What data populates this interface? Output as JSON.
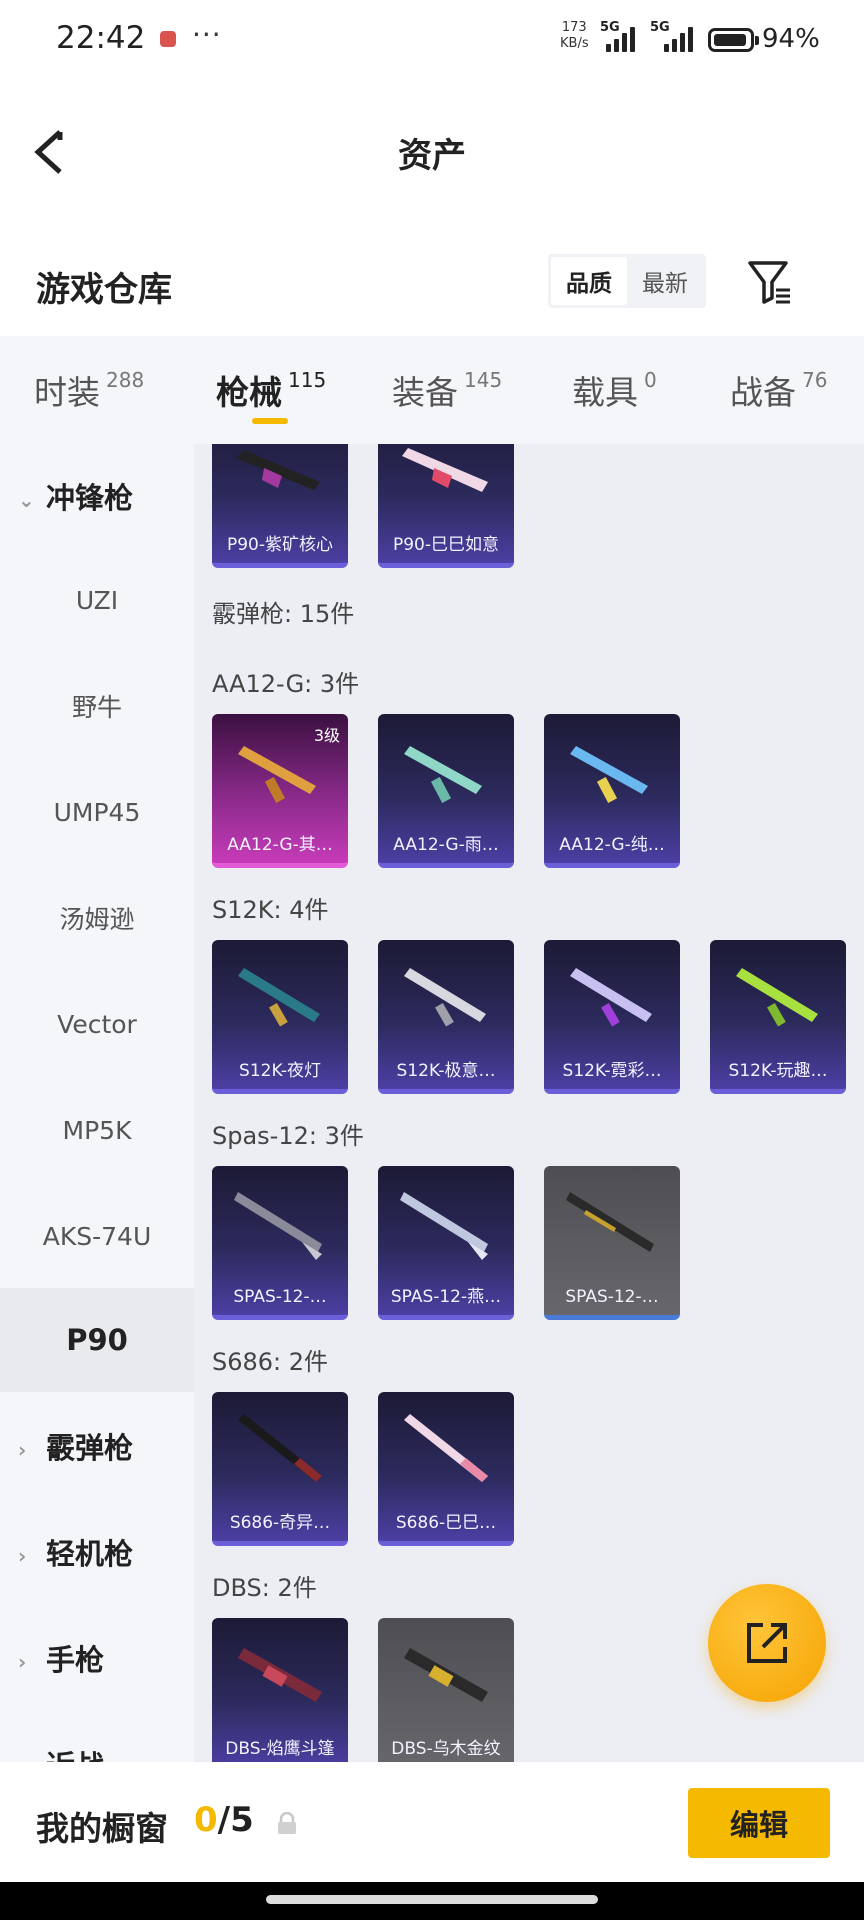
{
  "status_bar": {
    "time": "22:42",
    "more": "···",
    "net_speed_value": "173",
    "net_speed_unit": "KB/s",
    "network_1": "5G",
    "network_2": "5G",
    "battery": "94%"
  },
  "nav": {
    "title": "资产"
  },
  "section": {
    "title": "游戏仓库",
    "sort_options": [
      "品质",
      "最新"
    ],
    "sort_selected": "品质"
  },
  "tabs": [
    {
      "label": "时装",
      "count": "288"
    },
    {
      "label": "枪械",
      "count": "115",
      "active": true
    },
    {
      "label": "装备",
      "count": "145"
    },
    {
      "label": "载具",
      "count": "0"
    },
    {
      "label": "战备",
      "count": "76"
    }
  ],
  "sidebar": {
    "items": [
      {
        "label": "冲锋枪",
        "type": "group",
        "expanded": true
      },
      {
        "label": "UZI"
      },
      {
        "label": "野牛"
      },
      {
        "label": "UMP45"
      },
      {
        "label": "汤姆逊"
      },
      {
        "label": "Vector"
      },
      {
        "label": "MP5K"
      },
      {
        "label": "AKS-74U"
      },
      {
        "label": "P90",
        "selected": true
      },
      {
        "label": "霰弹枪",
        "type": "group",
        "expanded": false
      },
      {
        "label": "轻机枪",
        "type": "group",
        "expanded": false
      },
      {
        "label": "手枪",
        "type": "group",
        "expanded": false
      },
      {
        "label": "近战",
        "type": "group",
        "expanded": false
      }
    ]
  },
  "content": {
    "p90_items": [
      "P90-紫矿核心",
      "P90-巳巳如意"
    ],
    "category_label": "霰弹枪: 15件",
    "groups": [
      {
        "label": "AA12-G: 3件",
        "items": [
          {
            "name": "AA12-G-其…",
            "level": "3级",
            "style": "pink"
          },
          {
            "name": "AA12-G-雨…"
          },
          {
            "name": "AA12-G-纯…"
          }
        ]
      },
      {
        "label": "S12K: 4件",
        "items": [
          {
            "name": "S12K-夜灯"
          },
          {
            "name": "S12K-极意…"
          },
          {
            "name": "S12K-霓彩…"
          },
          {
            "name": "S12K-玩趣…"
          }
        ]
      },
      {
        "label": "Spas-12: 3件",
        "items": [
          {
            "name": "SPAS-12-…"
          },
          {
            "name": "SPAS-12-燕…"
          },
          {
            "name": "SPAS-12-…",
            "style": "grey"
          }
        ]
      },
      {
        "label": "S686: 2件",
        "items": [
          {
            "name": "S686-奇异…"
          },
          {
            "name": "S686-巳巳…"
          }
        ]
      },
      {
        "label": "DBS: 2件",
        "items": [
          {
            "name": "DBS-焰鹰斗篷"
          },
          {
            "name": "DBS-乌木金纹",
            "style": "grey"
          }
        ]
      }
    ]
  },
  "bottom_bar": {
    "title": "我的橱窗",
    "current": "0",
    "total": "/5",
    "edit_label": "编辑"
  },
  "colors": {
    "accent": "#f5b900",
    "card_purple": "#4b3fa3",
    "card_pink": "#c63bb8",
    "card_grey": "#5d5d62"
  }
}
